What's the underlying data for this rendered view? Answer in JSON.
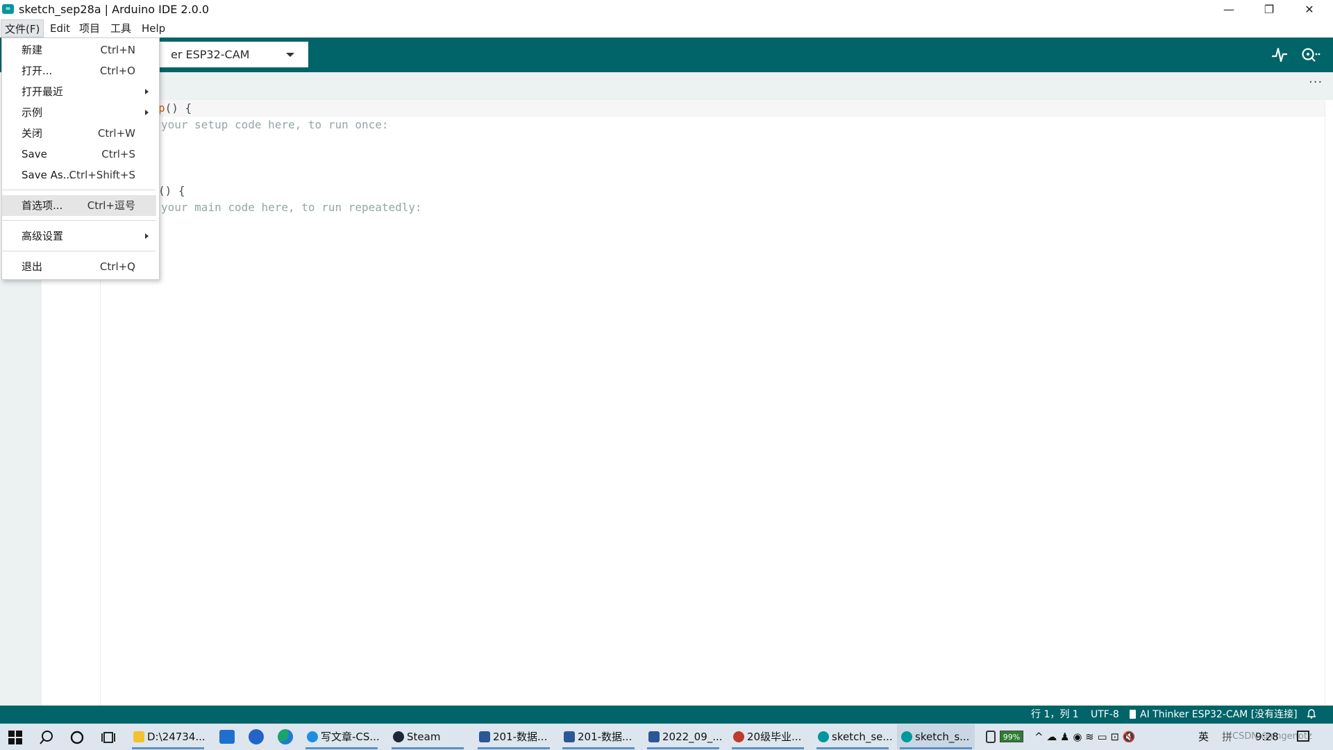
{
  "window": {
    "title": "sketch_sep28a | Arduino IDE 2.0.0",
    "logo": "∞",
    "minimize_glyph": "—",
    "maximize_glyph": "❐",
    "close_glyph": "✕"
  },
  "menubar": {
    "items": [
      "文件(F)",
      "Edit",
      "项目",
      "工具",
      "Help"
    ]
  },
  "toolbar": {
    "board": "er ESP32-CAM",
    "icons": [
      "serial-plotter-icon",
      "serial-monitor-icon"
    ]
  },
  "editor": {
    "more": "···",
    "lines": [
      {
        "kw": "p",
        "rest": "() {"
      },
      {
        "comment": "your setup code here, to run once:"
      },
      {
        "kw": "",
        "rest": "() {"
      },
      {
        "comment": "your main code here, to run repeatedly:"
      }
    ]
  },
  "file_menu": {
    "items": [
      {
        "label": "新建",
        "shortcut": "Ctrl+N"
      },
      {
        "label": "打开...",
        "shortcut": "Ctrl+O"
      },
      {
        "label": "打开最近",
        "shortcut": ""
      },
      {
        "label": "示例",
        "shortcut": ""
      },
      {
        "label": "关闭",
        "shortcut": "Ctrl+W"
      },
      {
        "label": "Save",
        "shortcut": "Ctrl+S"
      },
      {
        "label": "Save As...",
        "shortcut": "Ctrl+Shift+S"
      },
      {
        "label": "首选项...",
        "shortcut": "Ctrl+逗号"
      },
      {
        "label": "高级设置",
        "shortcut": ""
      },
      {
        "label": "退出",
        "shortcut": "Ctrl+Q"
      }
    ]
  },
  "statusbar": {
    "position": "行 1，列 1",
    "encoding": "UTF-8",
    "board": "AI Thinker ESP32-CAM [没有连接]"
  },
  "taskbar": {
    "apps": [
      {
        "label": "D:\\24734...",
        "color": "#f2c230"
      },
      {
        "label": "写文章-CS...",
        "color": "#1f8ee0"
      },
      {
        "label": "Steam",
        "color": "#1b2838"
      },
      {
        "label": "201-数据...",
        "color": "#2b5797"
      },
      {
        "label": "201-数据...",
        "color": "#2b5797"
      },
      {
        "label": "2022_09_...",
        "color": "#2b5797"
      },
      {
        "label": "20级毕业...",
        "color": "#c0392b"
      },
      {
        "label": "sketch_se...",
        "color": "#00979d"
      },
      {
        "label": "sketch_s...",
        "color": "#00979d"
      }
    ],
    "battery": "99%",
    "tray_glyphs": "^  ☁  ♟  ◉  ≋  ▭  ⊡  🔇",
    "ime": "英",
    "ime2": "拼",
    "clock": "9:28",
    "watermark": "CSDN @engenotz"
  }
}
